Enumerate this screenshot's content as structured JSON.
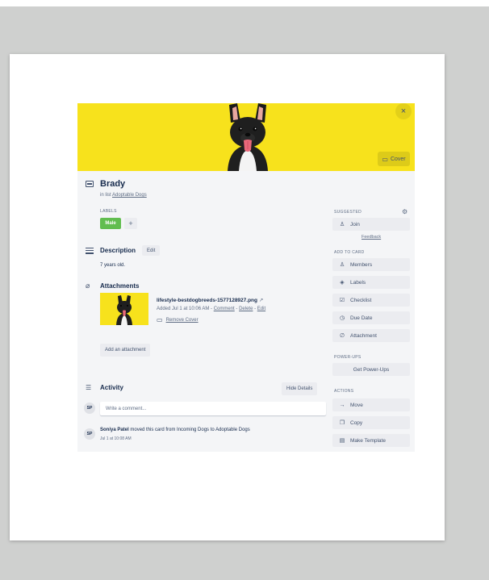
{
  "card": {
    "title": "Brady",
    "list_prefix": "in list ",
    "list_name": "Adoptable Dogs",
    "close_label": "×",
    "cover_button": "Cover"
  },
  "labels": {
    "heading": "LABELS",
    "items": [
      {
        "text": "Male",
        "color": "#61bd4f"
      }
    ],
    "add": "+"
  },
  "description": {
    "heading": "Description",
    "edit": "Edit",
    "text": "7 years old."
  },
  "attachments": {
    "heading": "Attachments",
    "file_name": "lifestyle-bestdogbreeds-1577128927.png",
    "added_prefix": "Added Jul 1 at 10:06 AM - ",
    "comment": "Comment",
    "delete": "Delete",
    "edit": "Edit",
    "sep": " - ",
    "remove_cover": "Remove Cover",
    "add_button": "Add an attachment"
  },
  "activity": {
    "heading": "Activity",
    "hide_details": "Hide Details",
    "avatar_initials": "SP",
    "comment_placeholder": "Write a comment...",
    "entry_user": "Soniya Patel",
    "entry_text": " moved this card from Incoming Dogs to Adoptable Dogs",
    "entry_time": "Jul 1 at 10:08 AM"
  },
  "sidebar": {
    "suggested_heading": "SUGGESTED",
    "join": "Join",
    "feedback": "Feedback",
    "add_to_card_heading": "ADD TO CARD",
    "add_items": [
      "Members",
      "Labels",
      "Checklist",
      "Due Date",
      "Attachment"
    ],
    "powerups_heading": "POWER-UPS",
    "get_powerups": "Get Power-Ups",
    "actions_heading": "ACTIONS",
    "action_items": [
      "Move",
      "Copy",
      "Make Template"
    ]
  },
  "colors": {
    "cover": "#f7e21c",
    "label_green": "#61bd4f",
    "panel": "#f4f5f7",
    "button": "#ebecf0"
  },
  "icons": {
    "title": "card-icon",
    "description": "lines-icon",
    "attachments": "paperclip-icon",
    "activity": "activity-list-icon",
    "settings": "gear-icon"
  }
}
